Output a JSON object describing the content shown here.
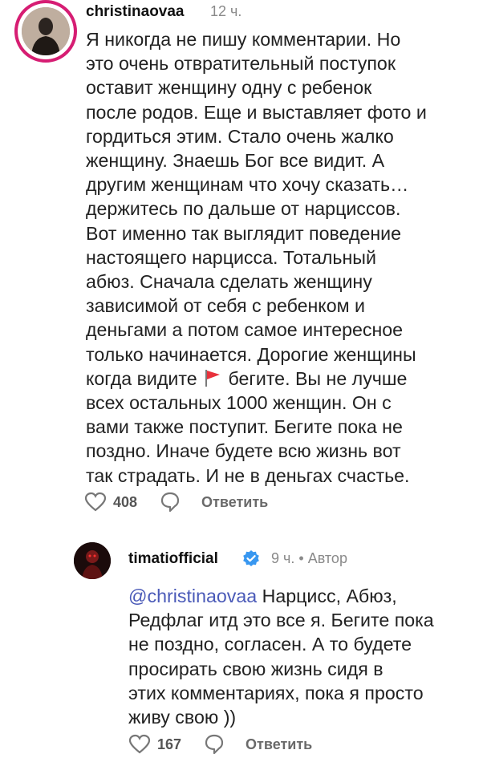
{
  "comments": [
    {
      "username": "christinaovaa",
      "time": "12 ч.",
      "lines": [
        "Я никогда не пишу комментарии. Но",
        "это очень отвратительный поступок",
        "оставит женщину одну с ребенок",
        "после родов. Еще и выставляет фото и",
        "гордиться этим. Стало очень жалко",
        "женщину. Знаешь Бог все видит. А",
        "другим женщинам что хочу сказать…",
        "держитесь по дальше от нарциссов.",
        "Вот именно так выглядит поведение",
        "настоящего нарцисса. Тотальный",
        "абюз. Сначала сделать женщину",
        "зависимой от себя с ребенком и",
        "деньгами а потом самое интересное",
        "только начинается. Дорогие женщины"
      ],
      "flag_line_before": "когда видите",
      "flag_line_after": "бегите. Вы не лучше",
      "lines_after": [
        "всех остальных 1000 женщин. Он с",
        "вами также поступит. Бегите пока не",
        "поздно. Иначе будете всю жизнь вот",
        "так страдать. И не в деньгах счастье."
      ],
      "likes": "408",
      "reply_label": "Ответить"
    },
    {
      "username": "timatiofficial",
      "time": "9 ч.",
      "author_badge": "Автор",
      "mention": "@christinaovaa",
      "first_line_rest": " Нарцисс, Абюз,",
      "lines": [
        "Редфлаг итд это все я. Бегите пока",
        "не поздно, согласен. А то будете",
        "просирать свою жизнь сидя в",
        "этих комментариях, пока я просто",
        "живу свою ))"
      ],
      "likes": "167",
      "reply_label": "Ответить"
    }
  ],
  "colors": {
    "text": "#222222",
    "meta": "#8a8a8a",
    "mention": "#4a5ab8",
    "verified": "#3897f0",
    "flag": "#e8323c"
  }
}
